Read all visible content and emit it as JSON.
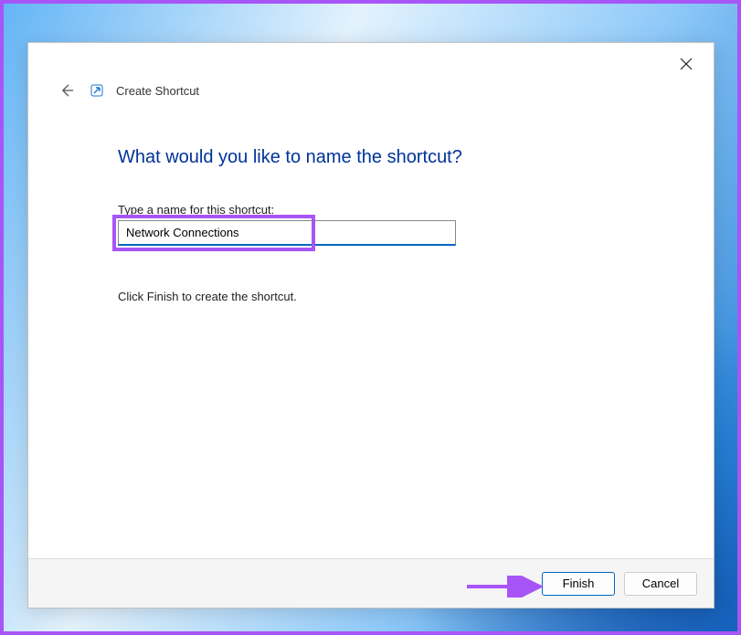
{
  "dialog": {
    "title": "Create Shortcut",
    "heading": "What would you like to name the shortcut?",
    "instruction": "Type a name for this shortcut:",
    "name_value": "Network Connections",
    "hint": "Click Finish to create the shortcut."
  },
  "buttons": {
    "finish": "Finish",
    "cancel": "Cancel"
  }
}
